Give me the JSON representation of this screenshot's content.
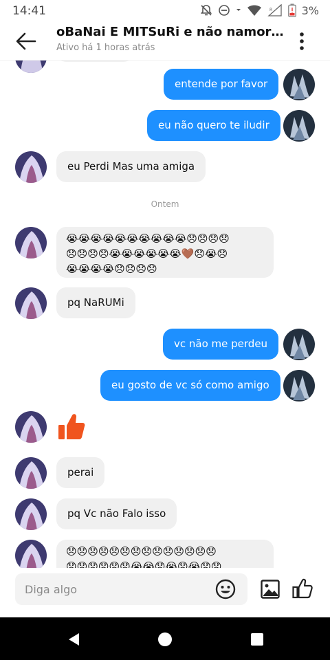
{
  "status_bar": {
    "time": "14:41",
    "battery_percent": "3%",
    "icons": [
      "notifications-off-icon",
      "do-not-disturb-icon",
      "wifi-icon",
      "signal-icon",
      "battery-low-icon"
    ]
  },
  "header": {
    "title": "oBaNai E MITSuRi  e não namora ...",
    "subtitle": "Ativo há 1 horas atrás",
    "back_icon": "arrow-left-icon",
    "menu_icon": "more-vertical-icon"
  },
  "chat": {
    "date_divider": "Ontem",
    "messages": [
      {
        "from": "me",
        "text": "entende por favor"
      },
      {
        "from": "me",
        "text": "eu não quero te iludir"
      },
      {
        "from": "them",
        "text": "eu Perdi Mas uma amiga"
      },
      {
        "from": "them",
        "emoji_rows": [
          "😭😭😭😭😭😭😭😭😭😭😞😞😞😞",
          "😞😞😞😞😭😭😭😭😭😭🤎😞😭😞",
          "😭😭😭😭😞😞😞😞"
        ]
      },
      {
        "from": "them",
        "text": "pq NaRUMi"
      },
      {
        "from": "me",
        "text": "vc não me perdeu"
      },
      {
        "from": "me",
        "text": "eu gosto de vc só como amigo"
      },
      {
        "from": "them",
        "thumb": "thumbs-up-icon"
      },
      {
        "from": "them",
        "text": "perai"
      },
      {
        "from": "them",
        "text": "pq Vc não Falo isso"
      },
      {
        "from": "them",
        "emoji_rows": [
          "😞😞😞😞😞😞😞😞😞😞😞😞😞😞",
          "😞😞😞😞😞😞😭😭😞😭😞😭😞😞"
        ]
      }
    ]
  },
  "composer": {
    "placeholder": "Diga algo",
    "emoji_icon": "smiley-icon",
    "gallery_icon": "image-icon",
    "like_icon": "thumbs-up-icon"
  },
  "colors": {
    "outgoing_bubble": "#1e90ff",
    "incoming_bubble": "#f0f0f0",
    "thumb_reaction": "#f0541e"
  }
}
